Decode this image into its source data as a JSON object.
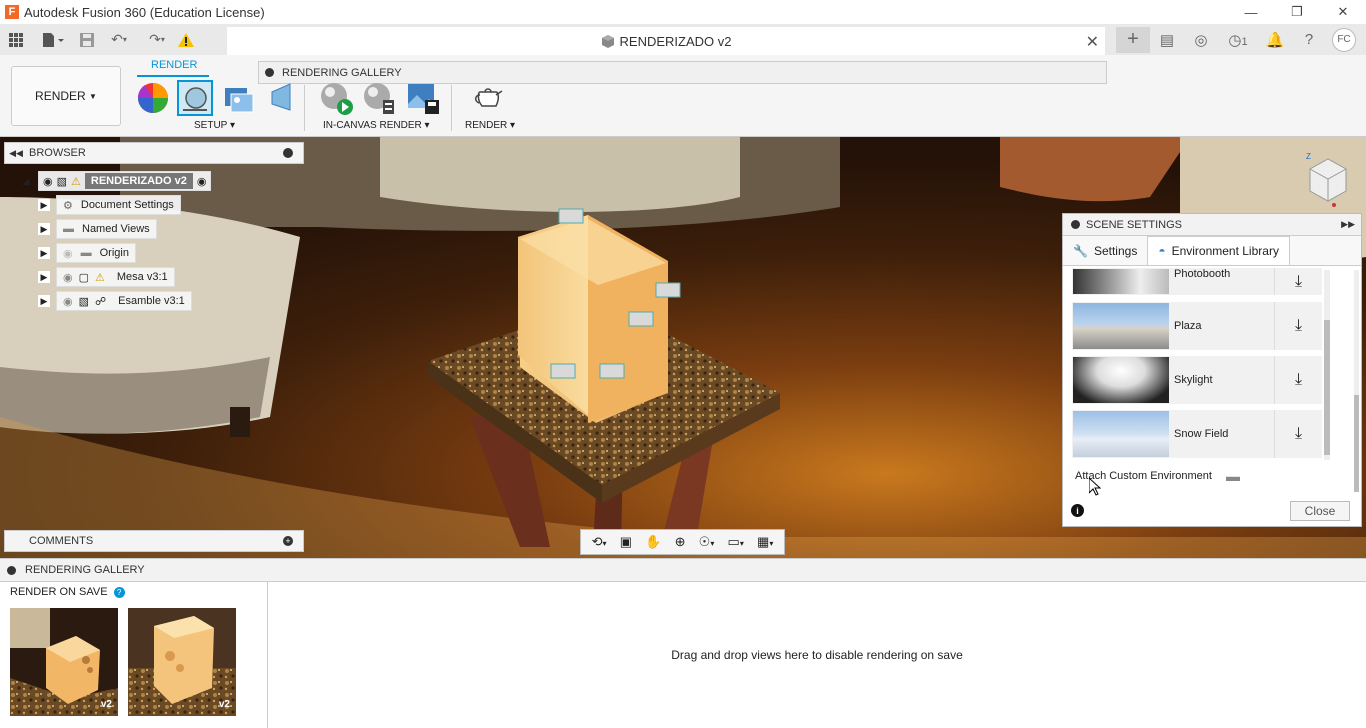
{
  "window": {
    "title": "Autodesk Fusion 360 (Education License)"
  },
  "document": {
    "tab_title": "RENDERIZADO v2",
    "job_count": "1",
    "user_initials": "FC"
  },
  "toolbar": {
    "workspace": "RENDER",
    "active_tab": "RENDER",
    "gallery_tooltip": "RENDERING GALLERY",
    "groups": [
      "SETUP",
      "IN-CANVAS RENDER",
      "RENDER"
    ]
  },
  "browser": {
    "title": "BROWSER",
    "root": "RENDERIZADO v2",
    "items": [
      "Document Settings",
      "Named Views",
      "Origin",
      "Mesa v3:1",
      "Esamble v3:1"
    ]
  },
  "comments": {
    "title": "COMMENTS"
  },
  "scene_settings": {
    "title": "SCENE SETTINGS",
    "tabs": [
      "Settings",
      "Environment Library"
    ],
    "active_tab": "Environment Library",
    "environments": [
      "Photobooth",
      "Plaza",
      "Skylight",
      "Snow Field"
    ],
    "attach_label": "Attach Custom Environment",
    "close_label": "Close"
  },
  "rendering_gallery": {
    "title": "RENDERING GALLERY",
    "render_on_save": "RENDER ON SAVE",
    "thumb_version": "v2",
    "drop_hint": "Drag and drop views here to disable rendering on save"
  },
  "colors": {
    "accent": "#0696d7",
    "warning": "#f5c400"
  }
}
